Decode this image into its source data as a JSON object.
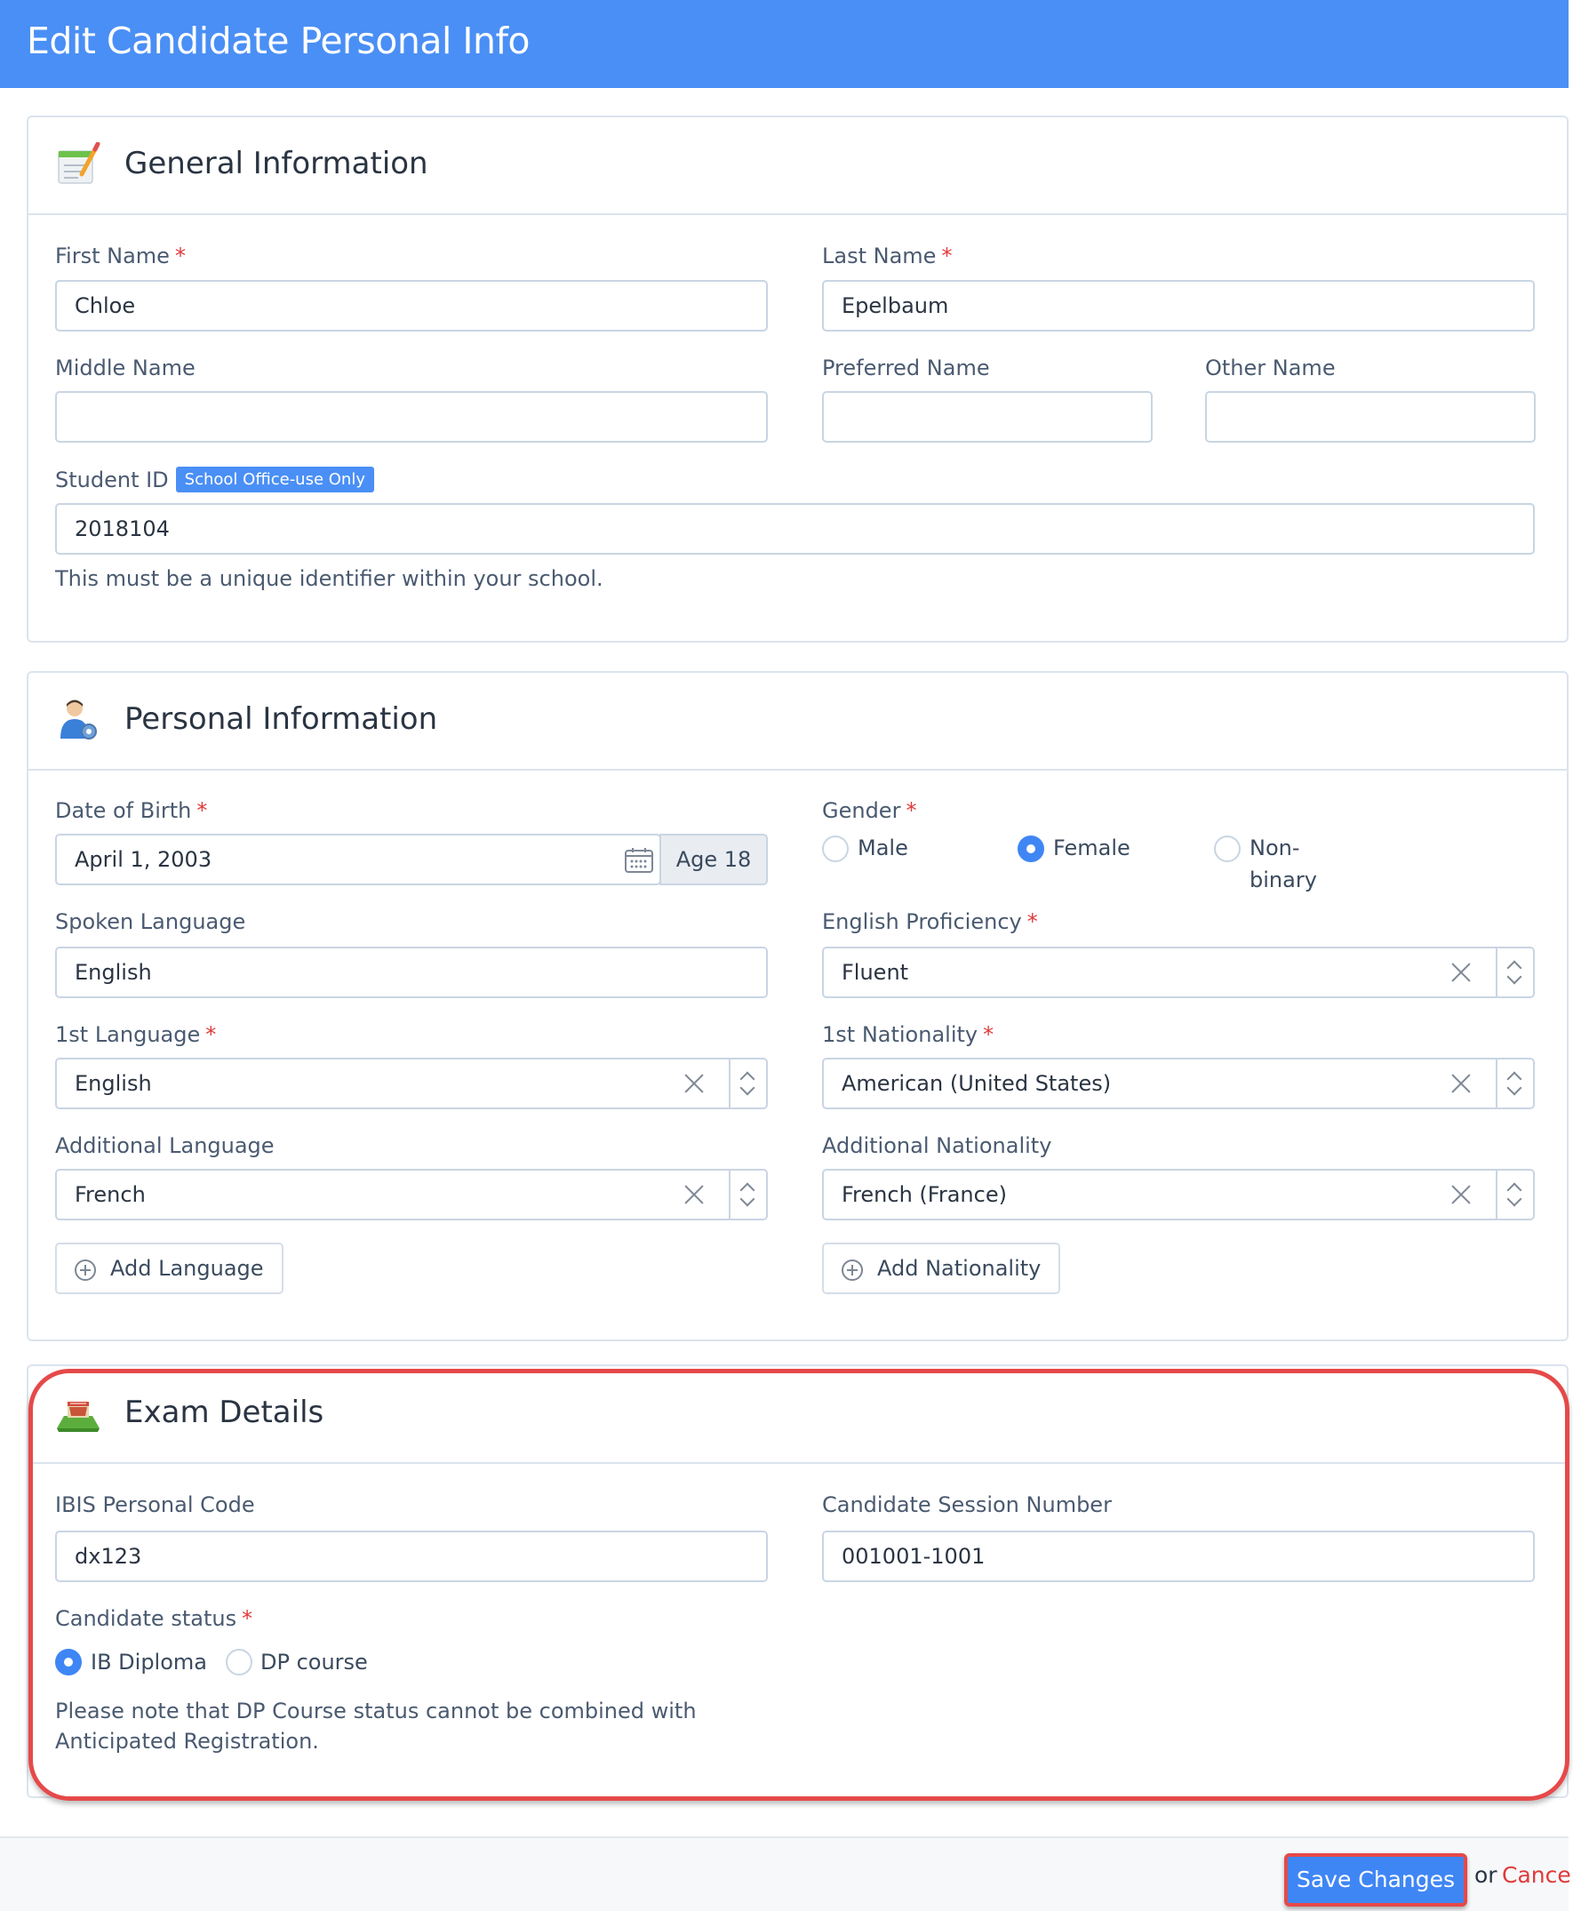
{
  "page": {
    "title": "Edit Candidate Personal Info"
  },
  "general": {
    "title": "General Information",
    "first_name": {
      "label": "First Name",
      "value": "Chloe"
    },
    "last_name": {
      "label": "Last Name",
      "value": "Epelbaum"
    },
    "middle_name": {
      "label": "Middle Name",
      "value": ""
    },
    "preferred_name": {
      "label": "Preferred Name",
      "value": ""
    },
    "other_name": {
      "label": "Other Name",
      "value": ""
    },
    "student_id": {
      "label": "Student ID",
      "badge": "School Office-use Only",
      "value": "2018104",
      "hint": "This must be a unique identifier within your school."
    }
  },
  "personal": {
    "title": "Personal Information",
    "dob": {
      "label": "Date of Birth",
      "value": "April 1, 2003",
      "age": "Age 18"
    },
    "gender": {
      "label": "Gender",
      "options": [
        "Male",
        "Female",
        "Non-",
        "binary"
      ],
      "selected": "Female"
    },
    "spoken_language": {
      "label": "Spoken Language",
      "value": "English"
    },
    "english_proficiency": {
      "label": "English Proficiency",
      "value": "Fluent"
    },
    "first_language": {
      "label": "1st Language",
      "value": "English"
    },
    "first_nationality": {
      "label": "1st Nationality",
      "value": "American (United States)"
    },
    "additional_language": {
      "label": "Additional Language",
      "value": "French"
    },
    "additional_nationality": {
      "label": "Additional Nationality",
      "value": "French (France)"
    },
    "add_language": "Add Language",
    "add_nationality": "Add Nationality"
  },
  "exam": {
    "title": "Exam Details",
    "ibis_code": {
      "label": "IBIS Personal Code",
      "value": "dx123"
    },
    "session_number": {
      "label": "Candidate Session Number",
      "value": "001001-1001"
    },
    "candidate_status": {
      "label": "Candidate status",
      "options": [
        "IB Diploma",
        "DP course"
      ],
      "selected": "IB Diploma"
    },
    "note_line1": "Please note that DP Course status cannot be combined with",
    "note_line2": "Anticipated Registration."
  },
  "footer": {
    "save": "Save Changes",
    "or": "or",
    "cancel": "Cancel"
  },
  "colors": {
    "header": "#4a8ff5",
    "accent": "#3f86f5",
    "required": "#e03a3a",
    "highlight": "#e64949"
  },
  "icons": [
    "notepad-pencil-icon",
    "user-gear-icon",
    "calendar-icon",
    "exam-stage-icon",
    "clear-icon",
    "spinner-icon",
    "plus-circle-icon"
  ]
}
